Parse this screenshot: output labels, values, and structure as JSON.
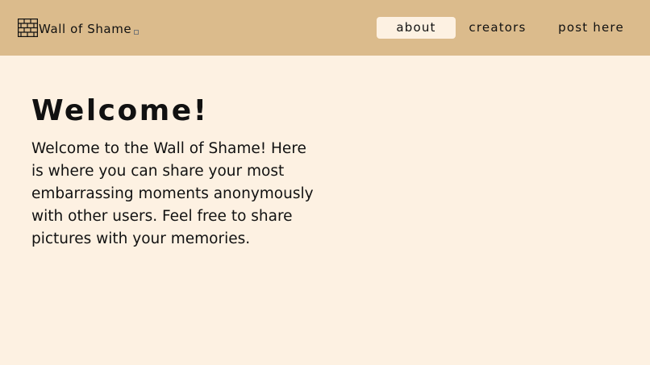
{
  "header": {
    "brand_icon": "brick-wall-icon",
    "brand_title": "Wall of Shame",
    "background_color": "#dbbb8c"
  },
  "nav": {
    "items": [
      {
        "label": "about",
        "active": true
      },
      {
        "label": "creators",
        "active": false
      },
      {
        "label": "post here",
        "active": false
      }
    ]
  },
  "main": {
    "title": "Welcome!",
    "intro": "Welcome to the Wall of Shame! Here is where you can share your most embarrassing moments anonymously with other users. Feel free to share pictures with your memories."
  },
  "colors": {
    "page_background": "#fdf1e2",
    "header_background": "#dbbb8c",
    "active_tab_background": "#fdf1e2",
    "text": "#111111"
  }
}
